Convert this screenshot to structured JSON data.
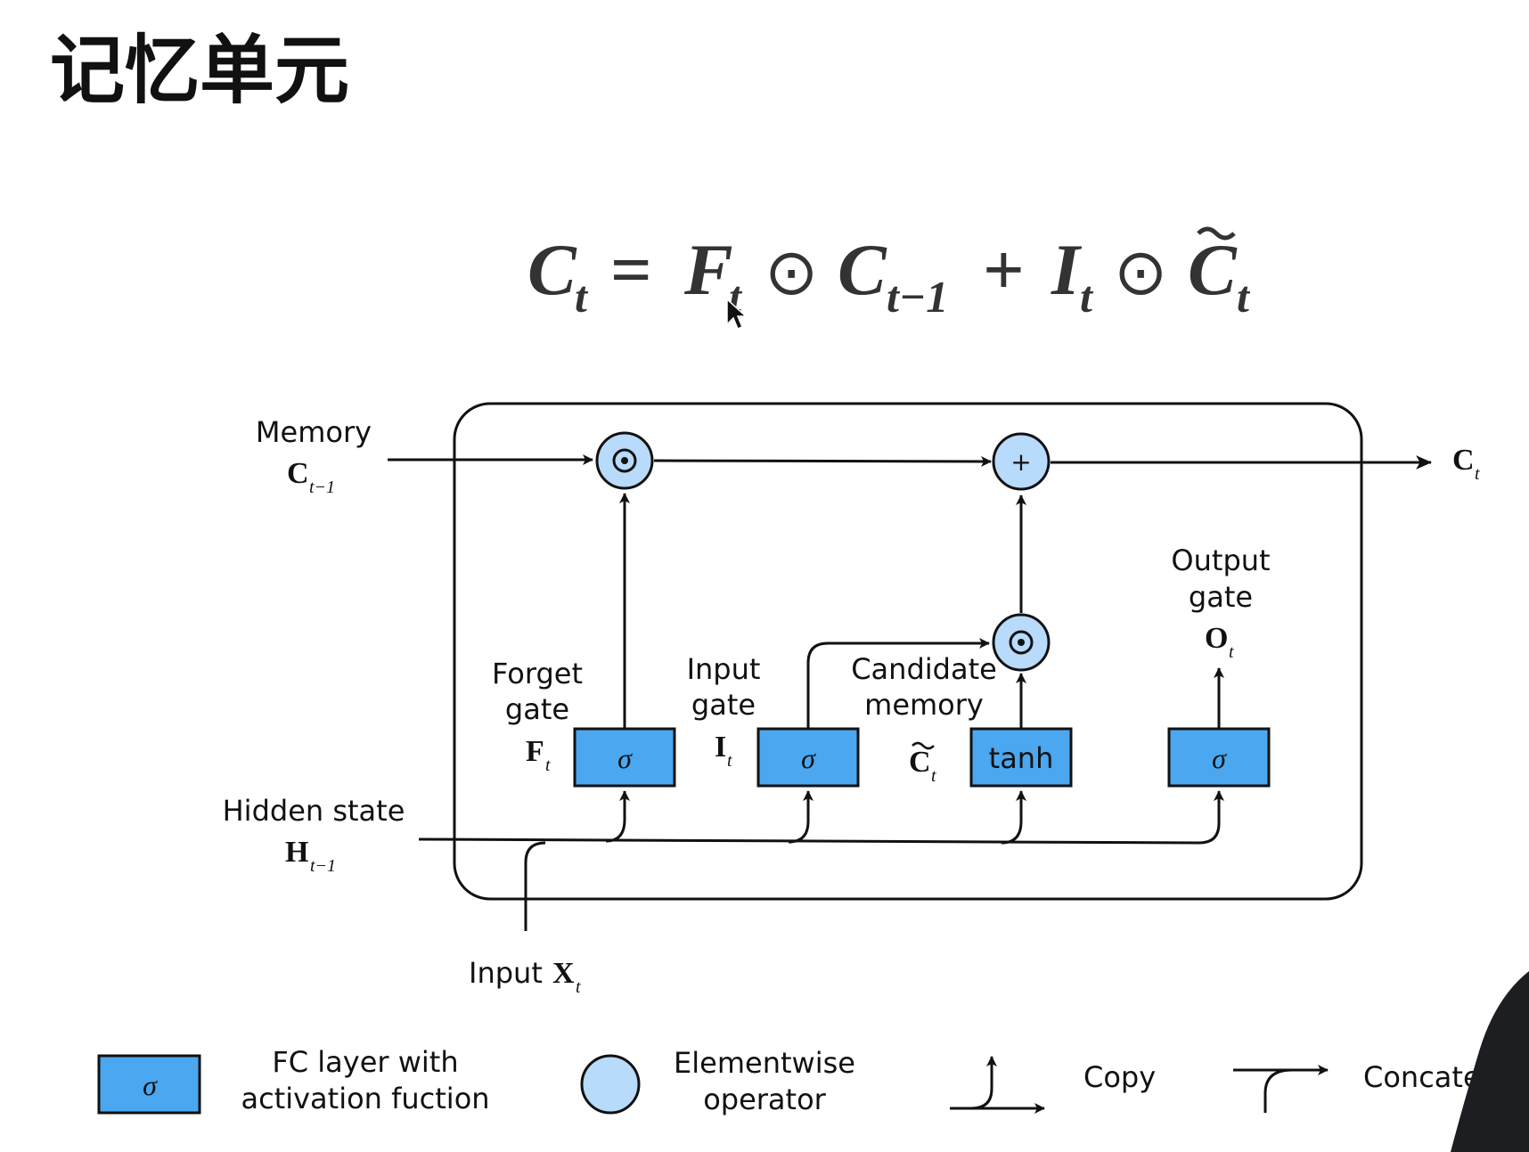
{
  "slide": {
    "title": "记忆单元"
  },
  "equation": {
    "lhs": "C",
    "lhs_sub": "t",
    "equals": "=",
    "forget_symbol": "F",
    "forget_sub": "t",
    "odot": "⊙",
    "prev_memory_symbol": "C",
    "prev_memory_sub": "t−1",
    "plus": "+",
    "input_symbol": "I",
    "input_sub": "t",
    "candidate_symbol": "C",
    "candidate_sub": "t"
  },
  "diagram": {
    "memory_label": "Memory",
    "memory_symbol": "C",
    "memory_sub": "t−1",
    "output_memory_symbol": "C",
    "output_memory_sub": "t",
    "hidden_label": "Hidden state",
    "hidden_symbol": "H",
    "hidden_sub": "t−1",
    "input_prefix": "Input",
    "input_symbol": "X",
    "input_sub": "t",
    "forget_gate_line1": "Forget",
    "forget_gate_line2": "gate",
    "forget_gate_symbol": "F",
    "forget_gate_sub": "t",
    "input_gate_line1": "Input",
    "input_gate_line2": "gate",
    "input_gate_symbol": "I",
    "input_gate_sub": "t",
    "candidate_line1": "Candidate",
    "candidate_line2": "memory",
    "candidate_symbol": "C",
    "candidate_sub": "t",
    "output_gate_line1": "Output",
    "output_gate_line2": "gate",
    "output_gate_symbol": "O",
    "output_gate_sub": "t",
    "sigma": "σ",
    "tanh": "tanh",
    "plus_op": "+"
  },
  "legend": {
    "fc_line1": "FC layer with",
    "fc_line2": "activation fuction",
    "fc_symbol": "σ",
    "elementwise_line1": "Elementwise",
    "elementwise_line2": "operator",
    "copy": "Copy",
    "concat": "Concate"
  },
  "colors": {
    "box_fill": "#4aa7f0",
    "circle_fill": "#b8dafb",
    "stroke": "#111111"
  },
  "icons": [
    "cursor-icon"
  ]
}
